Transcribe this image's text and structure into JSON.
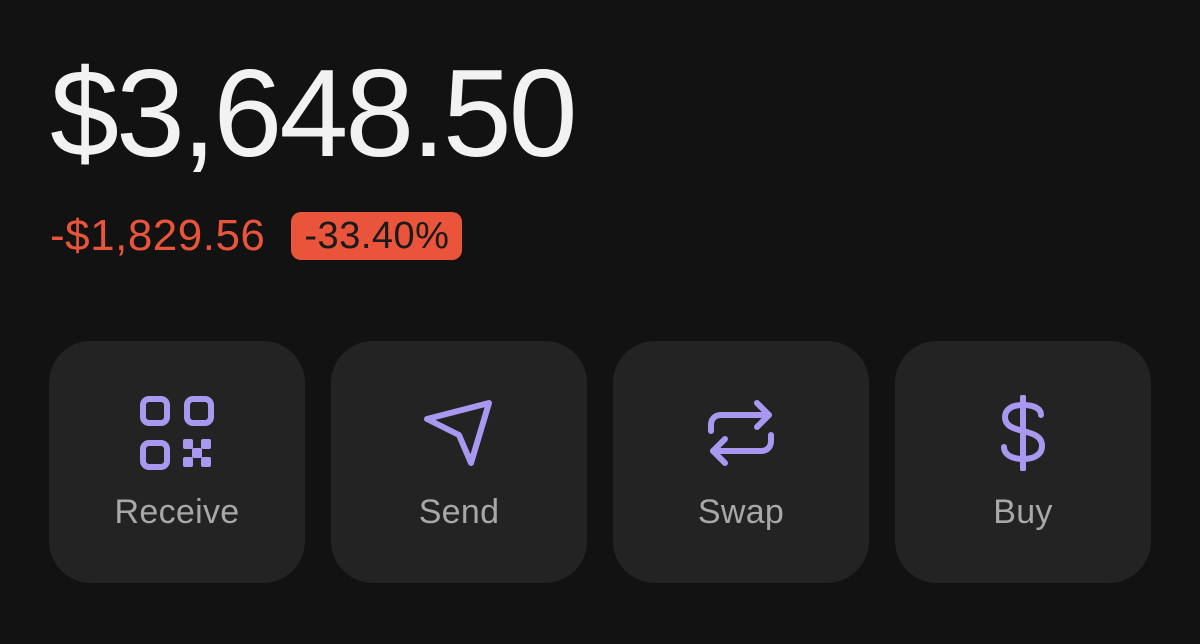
{
  "wallet": {
    "balance": "$3,648.50",
    "change_amount": "-$1,829.56",
    "change_percent": "-33.40%"
  },
  "colors": {
    "negative": "#e9543a",
    "icon_accent": "#a998f0",
    "card_bg": "#232323",
    "page_bg": "#121212"
  },
  "actions": [
    {
      "label": "Receive",
      "icon": "qr-code-icon"
    },
    {
      "label": "Send",
      "icon": "send-arrow-icon"
    },
    {
      "label": "Swap",
      "icon": "swap-arrows-icon"
    },
    {
      "label": "Buy",
      "icon": "dollar-sign-icon"
    }
  ]
}
